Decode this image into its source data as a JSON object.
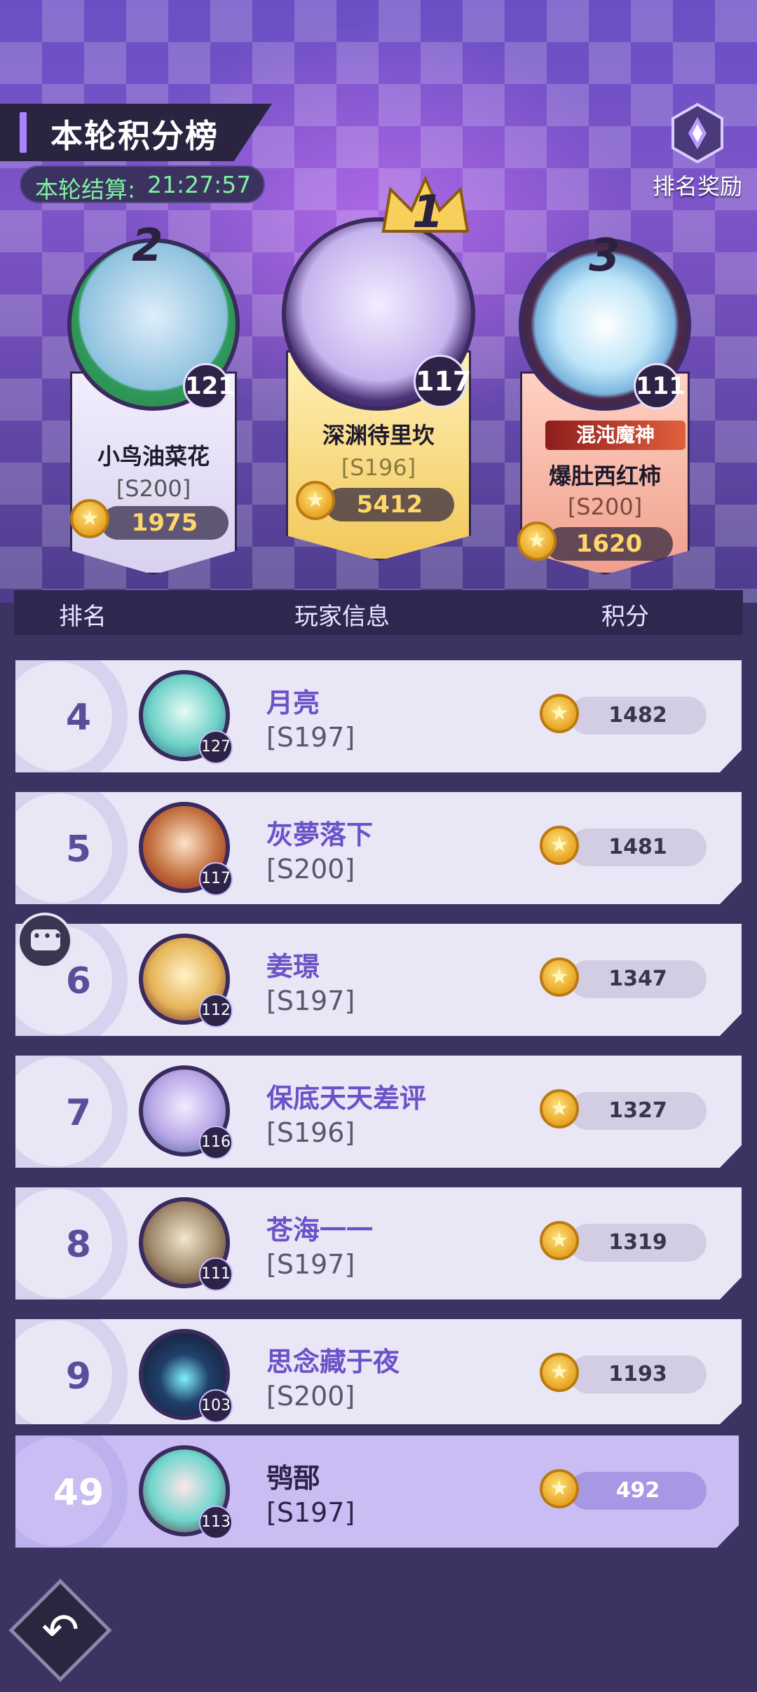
{
  "header": {
    "title": "本轮积分榜",
    "timer_label": "本轮结算:",
    "timer_value": "21:27:57",
    "reward_label": "排名奖励"
  },
  "podium": [
    {
      "rank": "2",
      "name": "小鸟油菜花",
      "server": "[S200]",
      "level": "121",
      "score": "1975"
    },
    {
      "rank": "1",
      "name": "深渊待里坎",
      "server": "[S196]",
      "level": "117",
      "score": "5412"
    },
    {
      "rank": "3",
      "title_badge": "混沌魔神",
      "name": "爆肚西红柿",
      "server": "[S200]",
      "level": "111",
      "score": "1620"
    }
  ],
  "columns": {
    "rank": "排名",
    "player": "玩家信息",
    "score": "积分"
  },
  "rows": [
    {
      "rank": "4",
      "name": "月亮",
      "server": "[S197]",
      "level": "127",
      "score": "1482"
    },
    {
      "rank": "5",
      "name": "灰夢落下",
      "server": "[S200]",
      "level": "117",
      "score": "1481"
    },
    {
      "rank": "6",
      "name": "姜璟",
      "server": "[S197]",
      "level": "112",
      "score": "1347"
    },
    {
      "rank": "7",
      "name": "保底天天差评",
      "server": "[S196]",
      "level": "116",
      "score": "1327"
    },
    {
      "rank": "8",
      "name": "苍海一一",
      "server": "[S197]",
      "level": "111",
      "score": "1319"
    },
    {
      "rank": "9",
      "name": "思念藏于夜",
      "server": "[S200]",
      "level": "103",
      "score": "1193"
    }
  ],
  "me": {
    "rank": "49",
    "name": "鸮郚",
    "server": "[S197]",
    "level": "113",
    "score": "492"
  },
  "icons": {
    "reward": "trophy-icon",
    "chat": "chat-icon",
    "back": "back-arrow-icon",
    "score": "star-coin-icon"
  },
  "colors": {
    "accent": "#6b52c8",
    "score_gold": "#ffd66a",
    "timer_green": "#7ff0a0"
  }
}
